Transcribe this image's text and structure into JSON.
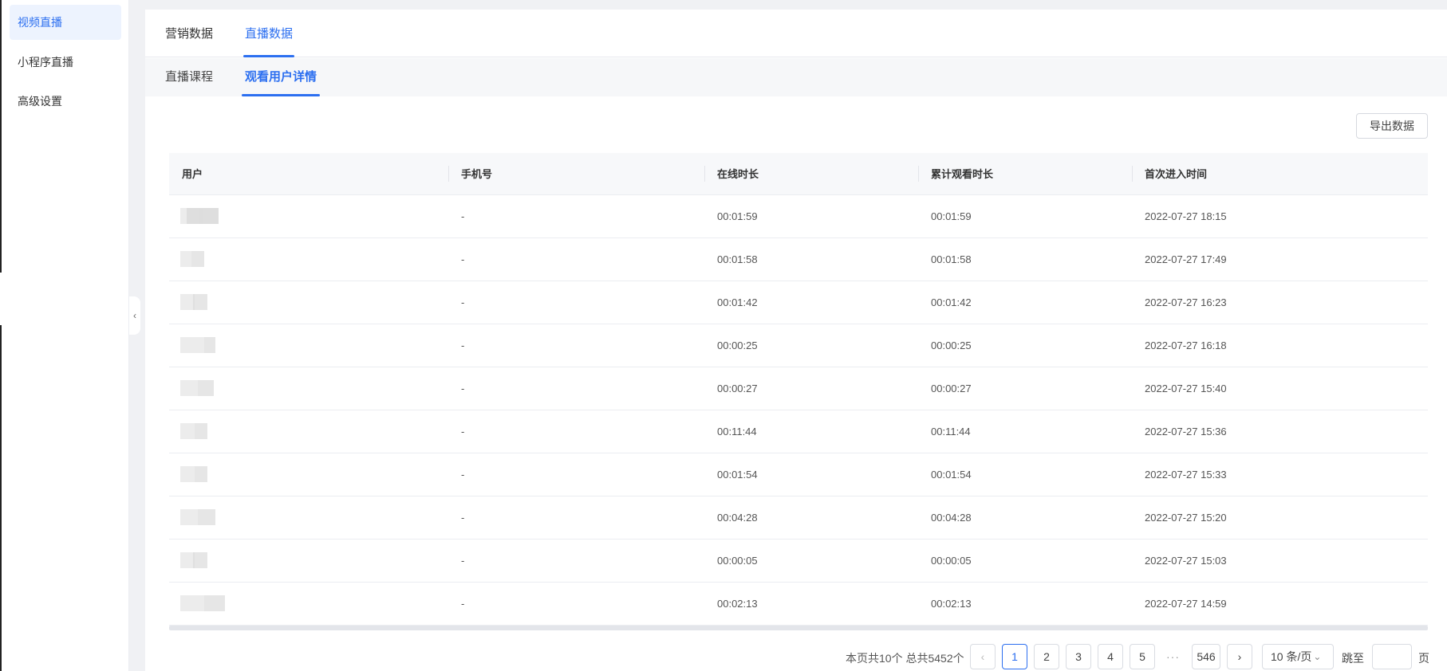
{
  "sidebar": {
    "items": [
      {
        "label": "视频直播",
        "active": true
      },
      {
        "label": "小程序直播",
        "active": false
      },
      {
        "label": "高级设置",
        "active": false
      }
    ]
  },
  "tabs": {
    "top": [
      "营销数据",
      "直播数据"
    ],
    "top_active": "直播数据",
    "sub": [
      "直播课程",
      "观看用户详情"
    ],
    "sub_active": "观看用户详情"
  },
  "toolbar": {
    "export_label": "导出数据"
  },
  "table": {
    "columns": [
      "用户",
      "手机号",
      "在线时长",
      "累计观看时长",
      "首次进入时间"
    ],
    "rows": [
      {
        "phone": "-",
        "online": "00:01:59",
        "total": "00:01:59",
        "first_enter": "2022-07-27 18:15"
      },
      {
        "phone": "-",
        "online": "00:01:58",
        "total": "00:01:58",
        "first_enter": "2022-07-27 17:49"
      },
      {
        "phone": "-",
        "online": "00:01:42",
        "total": "00:01:42",
        "first_enter": "2022-07-27 16:23"
      },
      {
        "phone": "-",
        "online": "00:00:25",
        "total": "00:00:25",
        "first_enter": "2022-07-27 16:18"
      },
      {
        "phone": "-",
        "online": "00:00:27",
        "total": "00:00:27",
        "first_enter": "2022-07-27 15:40"
      },
      {
        "phone": "-",
        "online": "00:11:44",
        "total": "00:11:44",
        "first_enter": "2022-07-27 15:36"
      },
      {
        "phone": "-",
        "online": "00:01:54",
        "total": "00:01:54",
        "first_enter": "2022-07-27 15:33"
      },
      {
        "phone": "-",
        "online": "00:04:28",
        "total": "00:04:28",
        "first_enter": "2022-07-27 15:20"
      },
      {
        "phone": "-",
        "online": "00:00:05",
        "total": "00:00:05",
        "first_enter": "2022-07-27 15:03"
      },
      {
        "phone": "-",
        "online": "00:02:13",
        "total": "00:02:13",
        "first_enter": "2022-07-27 14:59"
      }
    ]
  },
  "pagination": {
    "summary": "本页共10个 总共5452个",
    "pages": [
      "1",
      "2",
      "3",
      "4",
      "5"
    ],
    "current": "1",
    "ellipsis": "···",
    "last": "546",
    "prev_icon": "chevron-left-icon",
    "next_icon": "chevron-right-icon",
    "page_size": "10 条/页",
    "jump_label": "跳至",
    "page_unit": "页"
  },
  "colors": {
    "accent": "#2c6ff0",
    "active_bg": "#edf3fe"
  }
}
